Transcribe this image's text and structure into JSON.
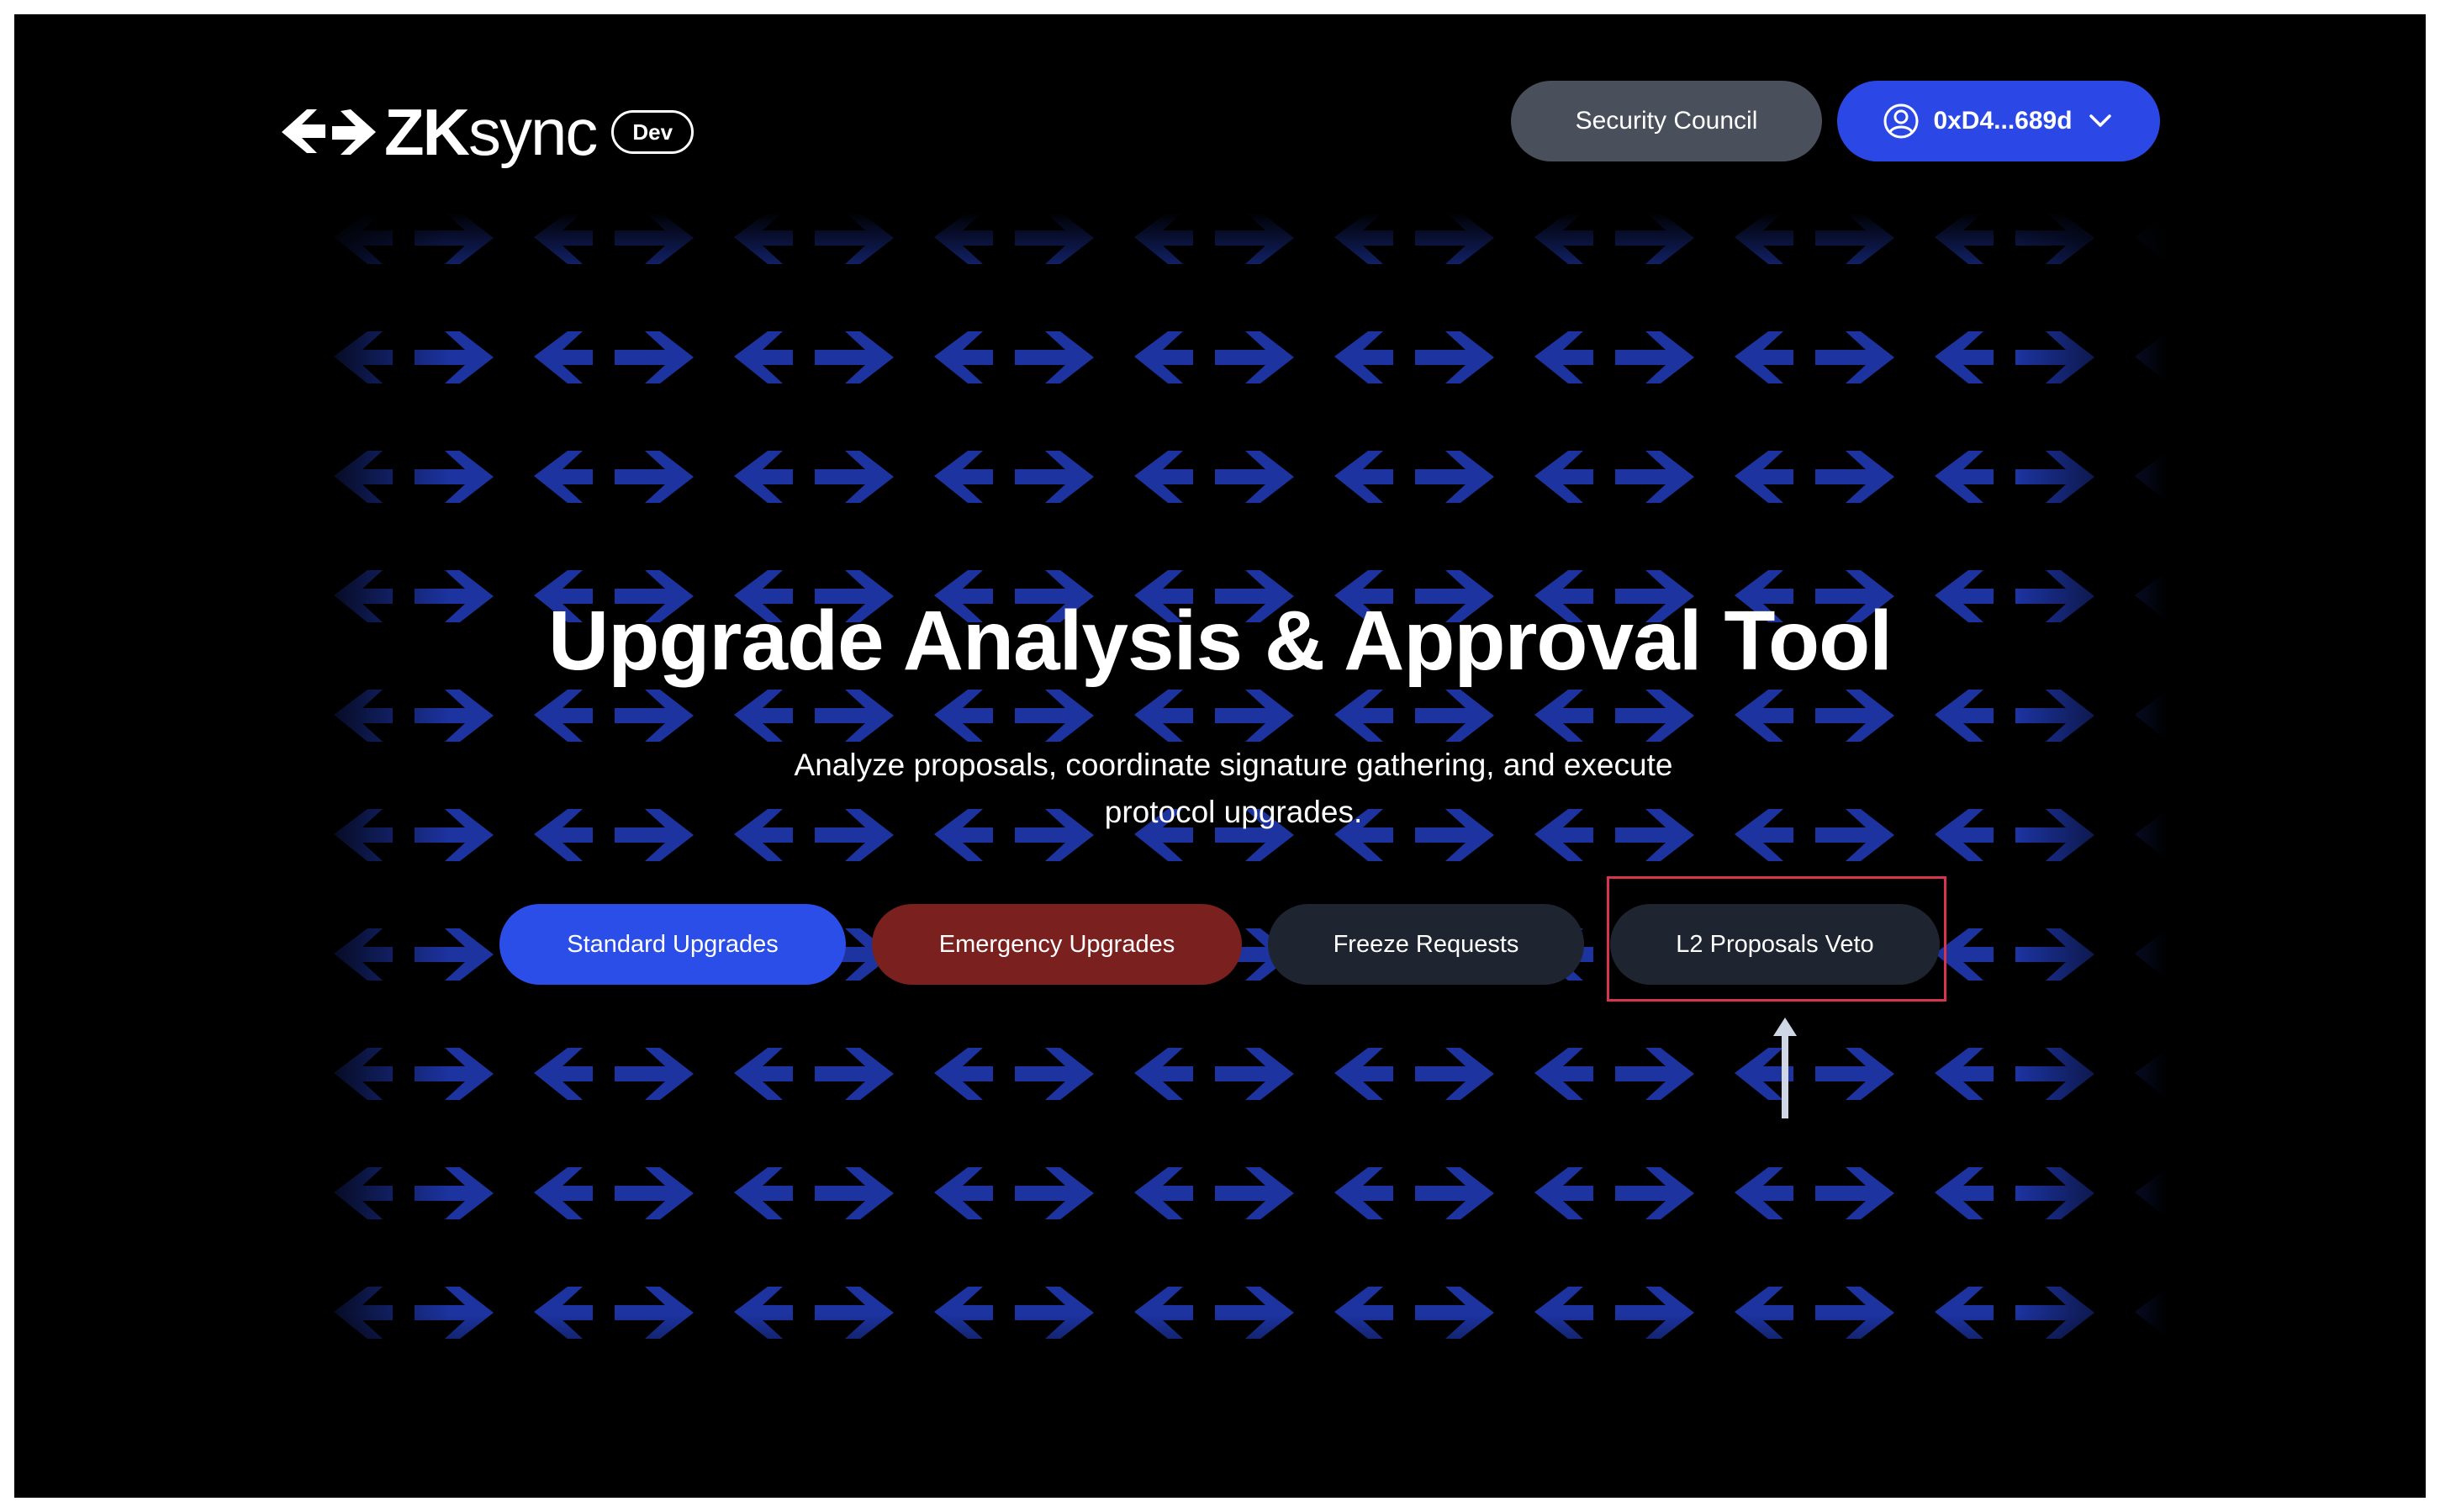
{
  "header": {
    "logo": {
      "icon": "zksync-arrows-logo",
      "brand_bold": "ZK",
      "brand_regular": "sync",
      "env_badge": "Dev"
    },
    "security_council_label": "Security Council",
    "wallet": {
      "address": "0xD4...689d",
      "avatar_icon": "user-circle-icon",
      "dropdown_icon": "chevron-down-icon"
    }
  },
  "hero": {
    "title": "Upgrade Analysis & Approval Tool",
    "subtitle": "Analyze proposals, coordinate signature gathering, and execute protocol upgrades."
  },
  "actions": [
    {
      "label": "Standard Upgrades",
      "color": "#2b4de8"
    },
    {
      "label": "Emergency Upgrades",
      "color": "#7a201f"
    },
    {
      "label": "Freeze Requests",
      "color": "#1f2530"
    },
    {
      "label": "L2 Proposals Veto",
      "color": "#1f2530"
    }
  ],
  "annotation": {
    "highlight_color": "#d9344e",
    "pointer_icon": "up-arrow-icon"
  },
  "colors": {
    "background": "#000000",
    "pattern": "#1d36a8",
    "primary_blue": "#2b48e6",
    "secondary_gray": "#4a505b"
  }
}
